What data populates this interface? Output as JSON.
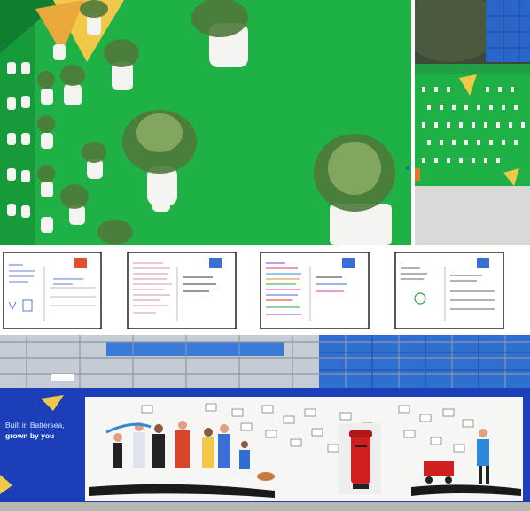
{
  "hoarding": {
    "slogan_line1": "Built in Battersea,",
    "slogan_line2": "grown by you"
  },
  "colors": {
    "wall_green": "#1fb145",
    "hoarding_blue": "#1a3fb8",
    "postbox_red": "#d11e1e",
    "petal_yellow": "#f2c84b",
    "scaffold_blue": "#2e6fd0"
  },
  "postcards": [
    {
      "id": "pc1",
      "stamp_color": "#e05030"
    },
    {
      "id": "pc2",
      "stamp_color": "#3a6fd8"
    },
    {
      "id": "pc3",
      "stamp_color": "#3a6fd8"
    },
    {
      "id": "pc4",
      "stamp_color": "#3a6fd8"
    }
  ]
}
